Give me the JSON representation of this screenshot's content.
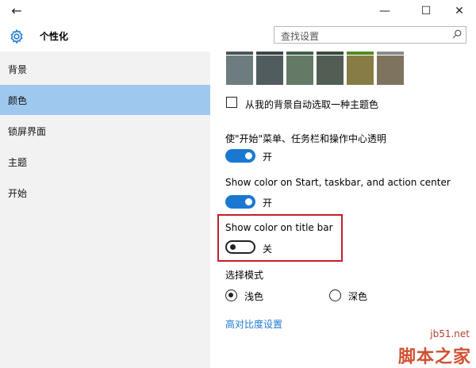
{
  "window": {
    "back_icon": "arrow-left-icon",
    "controls": [
      "minimize-icon",
      "maximize-icon",
      "close-icon"
    ]
  },
  "header": {
    "icon": "gear-icon",
    "title": "个性化",
    "search_placeholder": "查找设置"
  },
  "sidebar": {
    "items": [
      {
        "label": "背景"
      },
      {
        "label": "颜色",
        "active": true
      },
      {
        "label": "锁屏界面"
      },
      {
        "label": "主题"
      },
      {
        "label": "开始"
      }
    ]
  },
  "content": {
    "swatches": [
      {
        "color": "#6d7c7f",
        "top": "#4a5558"
      },
      {
        "color": "#515c5f",
        "top": "#3b4547"
      },
      {
        "color": "#647a67",
        "top": "#3f5f49"
      },
      {
        "color": "#525e54",
        "top": "#3a4a3c"
      },
      {
        "color": "#877c45",
        "top": "#4f8c1e"
      },
      {
        "color": "#7e735f",
        "top": "#8a8a8a"
      }
    ],
    "auto_pick": {
      "label": "从我的背景自动选取一种主题色",
      "checked": false
    },
    "transparency": {
      "label": "使\"开始\"菜单、任务栏和操作中心透明",
      "state": "开",
      "on": true
    },
    "start_color": {
      "label": "Show color on Start, taskbar, and action center",
      "state": "开",
      "on": true
    },
    "title_bar": {
      "label": "Show color on title bar",
      "state": "关",
      "on": false
    },
    "mode": {
      "label": "选择模式",
      "options": [
        {
          "label": "浅色",
          "selected": true
        },
        {
          "label": "深色",
          "selected": false
        }
      ]
    },
    "high_contrast_link": "高对比度设置"
  },
  "watermark": {
    "url": "jb51.net",
    "name": "脚本之家"
  },
  "colors": {
    "accent": "#1a78d2",
    "highlight": "#c0202a",
    "sidebar_bg": "#f2f2f2",
    "sidebar_active": "#9ec8ee"
  }
}
